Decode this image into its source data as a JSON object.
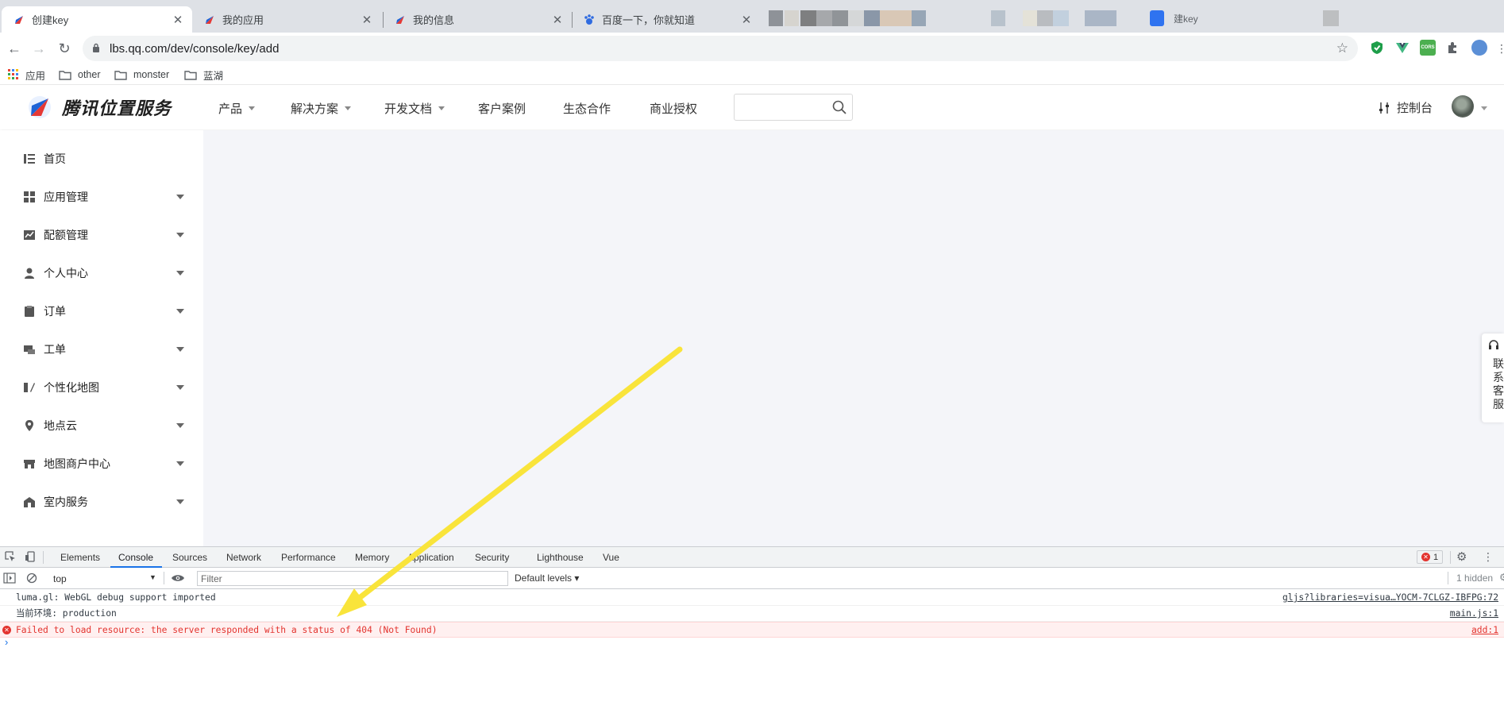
{
  "browser": {
    "tabs": [
      {
        "title": "创建key",
        "active": true
      },
      {
        "title": "我的应用",
        "active": false
      },
      {
        "title": "我的信息",
        "active": false
      },
      {
        "title": "百度一下，你就知道",
        "active": false
      }
    ],
    "partial_tab_title": "建key",
    "url": "lbs.qq.com/dev/console/key/add",
    "bookmarks": [
      {
        "label": "应用",
        "icon": "apps-grid-icon"
      },
      {
        "label": "other",
        "icon": "folder-icon"
      },
      {
        "label": "monster",
        "icon": "folder-icon"
      },
      {
        "label": "蓝湖",
        "icon": "folder-icon"
      }
    ],
    "extension_icons": [
      "shield-extension-icon",
      "vue-extension-icon",
      "cors-extension-icon",
      "puzzle-extensions-icon",
      "profile-icon"
    ],
    "cors_label": "CORS"
  },
  "site": {
    "brand": "腾讯位置服务",
    "nav": [
      {
        "label": "产品",
        "has_caret": true
      },
      {
        "label": "解决方案",
        "has_caret": true
      },
      {
        "label": "开发文档",
        "has_caret": true
      },
      {
        "label": "客户案例",
        "has_caret": false
      },
      {
        "label": "生态合作",
        "has_caret": false
      },
      {
        "label": "商业授权",
        "has_caret": false
      }
    ],
    "search_placeholder": "",
    "console_label": "控制台"
  },
  "sidebar": {
    "items": [
      {
        "label": "首页",
        "icon": "list-icon",
        "has_caret": false
      },
      {
        "label": "应用管理",
        "icon": "grid-icon",
        "has_caret": true
      },
      {
        "label": "配额管理",
        "icon": "chart-icon",
        "has_caret": true
      },
      {
        "label": "个人中心",
        "icon": "user-icon",
        "has_caret": true
      },
      {
        "label": "订单",
        "icon": "clipboard-icon",
        "has_caret": true
      },
      {
        "label": "工单",
        "icon": "ticket-icon",
        "has_caret": true
      },
      {
        "label": "个性化地图",
        "icon": "map-style-icon",
        "has_caret": true
      },
      {
        "label": "地点云",
        "icon": "location-pin-icon",
        "has_caret": true
      },
      {
        "label": "地图商户中心",
        "icon": "store-icon",
        "has_caret": true
      },
      {
        "label": "室内服务",
        "icon": "building-icon",
        "has_caret": true
      }
    ]
  },
  "float_service": {
    "label": "联系客服"
  },
  "devtools": {
    "tabs": [
      "Elements",
      "Console",
      "Sources",
      "Network",
      "Performance",
      "Memory",
      "Application",
      "Security",
      "Lighthouse",
      "Vue"
    ],
    "active_tab": "Console",
    "error_count": "1",
    "context": "top",
    "filter_placeholder": "Filter",
    "levels": "Default levels ▾",
    "hidden": "1 hidden",
    "logs": [
      {
        "level": "info",
        "message": "luma.gl: WebGL debug support imported",
        "source": "gljs?libraries=visua…YOCM-7CLGZ-IBFPG:72"
      },
      {
        "level": "info",
        "message": "当前环境: production",
        "source": "main.js:1"
      },
      {
        "level": "error",
        "message": "Failed to load resource: the server responded with a status of 404 (Not Found)",
        "source": "add:1"
      }
    ]
  },
  "annotation": {
    "color": "#f9e43b"
  }
}
